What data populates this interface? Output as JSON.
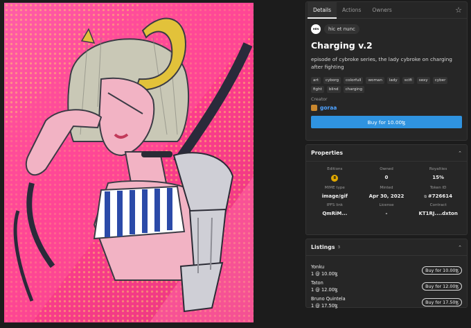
{
  "tabs": [
    "Details",
    "Actions",
    "Owners"
  ],
  "source": {
    "logo": "HEN",
    "label": "hic et nunc"
  },
  "title": "Charging v.2",
  "description": "episode of cybroke series, the lady cybroke on charging after fighting",
  "tags": [
    "art",
    "cyborg",
    "colorfull",
    "woman",
    "lady",
    "scifi",
    "sexy",
    "cyber",
    "fight",
    "blind",
    "charging"
  ],
  "creator": {
    "label": "Creator",
    "name": "goraa"
  },
  "buy_main": "Buy for 10.00ꜩ",
  "properties": {
    "title": "Properties",
    "cells": [
      {
        "key": "Editions",
        "value": "8",
        "badge": true
      },
      {
        "key": "Owned",
        "value": "0"
      },
      {
        "key": "Royalties",
        "value": "15%"
      },
      {
        "key": "MIME type",
        "value": "image/gif"
      },
      {
        "key": "Minted",
        "value": "Apr 30, 2022"
      },
      {
        "key": "Token ID",
        "value": "#726614"
      },
      {
        "key": "IPFS link",
        "value": "QmRiM..."
      },
      {
        "key": "License",
        "value": "-"
      },
      {
        "key": "Contract",
        "value": "KT1RJ....dxton"
      }
    ]
  },
  "listings": {
    "title": "Listings",
    "count": "3",
    "rows": [
      {
        "name": "Yonku",
        "price": "1 @ 10.00ꜩ",
        "button": "Buy for 10.00ꜩ"
      },
      {
        "name": "Taton",
        "price": "1 @ 12.00ꜩ",
        "button": "Buy for 12.00ꜩ"
      },
      {
        "name": "Bruno Quintela",
        "price": "1 @ 17.50ꜩ",
        "button": "Buy for 17.50ꜩ"
      }
    ]
  },
  "colors": {
    "accent": "#2f93e0",
    "link": "#4ea2ff",
    "art_bg": "#ff3d8e"
  }
}
